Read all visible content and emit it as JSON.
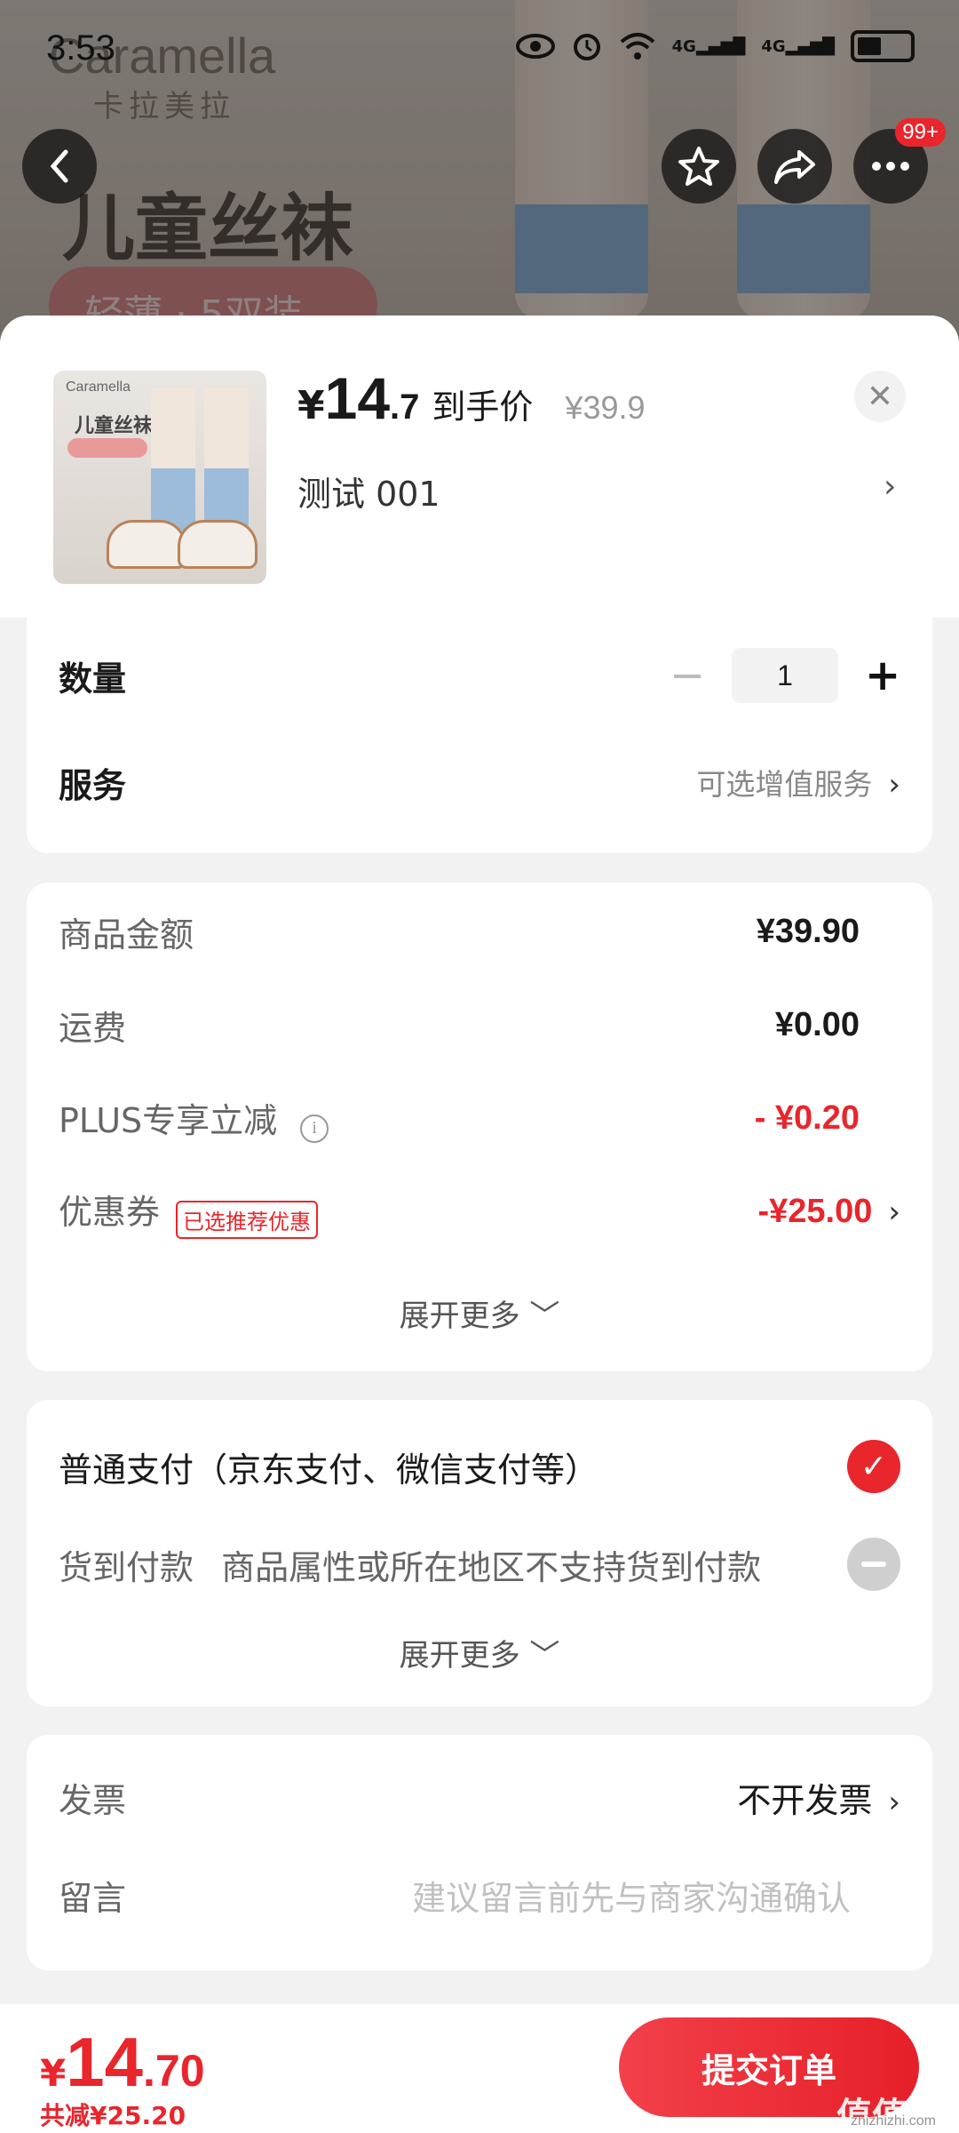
{
  "status_bar": {
    "time": "3:53",
    "signal1": "4G",
    "signal2": "4G"
  },
  "background": {
    "brand": "Caramella",
    "brand_cn": "卡拉美拉",
    "title": "儿童丝袜",
    "pill": "轻薄 · 5双装"
  },
  "nav": {
    "badge": "99+"
  },
  "product": {
    "thumb_brand": "Caramella",
    "thumb_title": "儿童丝袜",
    "price_yen": "¥",
    "price_int": "14",
    "price_dec": ".7",
    "price_label": "到手价",
    "original_price": "¥39.9",
    "spec": "测试  001",
    "close": "✕",
    "spec_chevron": "›"
  },
  "quantity": {
    "label": "数量",
    "value": "1",
    "minus": "−",
    "plus": "+"
  },
  "service": {
    "label": "服务",
    "hint": "可选增值服务",
    "chevron": "›"
  },
  "cost": {
    "items": [
      {
        "label": "商品金额",
        "value": "¥39.90"
      },
      {
        "label": "运费",
        "value": "¥0.00"
      },
      {
        "label": "PLUS专享立减",
        "value": "- ¥0.20"
      },
      {
        "label": "优惠券",
        "tag": "已选推荐优惠",
        "value": "-¥25.00"
      }
    ],
    "info_icon": "i",
    "chevron": "›",
    "expand": "展开更多 ﹀"
  },
  "payment": {
    "normal": "普通支付（京东支付、微信支付等）",
    "cod_label": "货到付款",
    "cod_note": "商品属性或所在地区不支持货到付款",
    "check": "✓",
    "expand": "展开更多 ﹀"
  },
  "invoice": {
    "label": "发票",
    "value": "不开发票",
    "chevron": "›"
  },
  "note": {
    "label": "留言",
    "placeholder": "建议留言前先与商家沟通确认"
  },
  "footer": {
    "total_yen": "¥",
    "total_int": "14",
    "total_dec": ".70",
    "saved": "共减¥25.20",
    "submit": "提交订单",
    "watermark": "值值值",
    "watermark_url": "zhizhizhi.com"
  },
  "colors": {
    "accent": "#e8262c",
    "background": "#f2f2f2"
  }
}
